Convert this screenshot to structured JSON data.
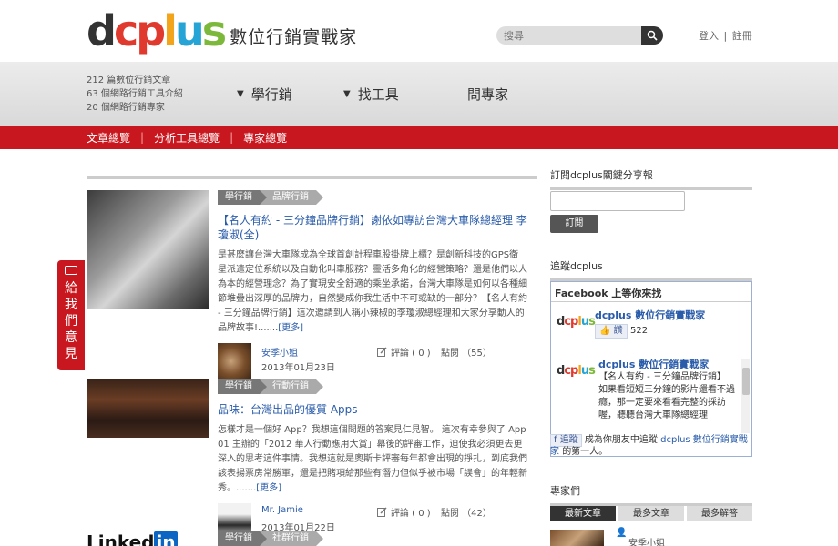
{
  "header": {
    "logo_text": "dcplus",
    "logo_subtitle": "數位行銷實戰家",
    "search_placeholder": "搜尋",
    "login_label": "登入",
    "register_label": "註冊",
    "link_separator": "|"
  },
  "stats": {
    "line1": "212 篇數位行銷文章",
    "line2": "63 個網路行銷工具介紹",
    "line3": "20 個網路行銷專家"
  },
  "main_nav": {
    "item1": "學行銷",
    "item2": "找工具",
    "item3": "問專家"
  },
  "sub_nav": {
    "item1": "文章總覽",
    "item2": "分析工具總覽",
    "item3": "專家總覽"
  },
  "feedback": {
    "label": "給我們意見"
  },
  "articles": [
    {
      "category": "學行銷",
      "subcategory": "品牌行銷",
      "title": "【名人有約 - 三分鐘品牌行銷】謝依如專訪台灣大車隊總經理 李瓊淑(全)",
      "body": "是甚麼讓台灣大車隊成為全球首創計程車股掛牌上櫃？是創新科技的GPS衛星派遣定位系統以及自動化叫車服務？靈活多角化的經營策略？還是他們以人為本的經營理念？為了實現安全舒適的乘坐承諾，台灣大車隊是如何以各種細節堆疊出深厚的品牌力，自然變成你我生活中不可或缺的一部分？【名人有約 - 三分鐘品牌行銷】這次邀請到人稱小辣椒的李瓊淑總經理和大家分享動人的品牌故事!.......",
      "more": "[更多]",
      "author": "安季小姐",
      "date": "2013年01月23日",
      "comments": "評論 ( 0 )",
      "views": "點閱 （55）"
    },
    {
      "category": "學行銷",
      "subcategory": "行動行銷",
      "title": "品味：台灣出品的優質 Apps",
      "body": "怎樣才是一個好 App？我想這個問題的答案見仁見智。 這次有幸參與了 App 01 主辦的「2012 華人行動應用大賞」幕後的評審工作，迫使我必須更去更深入的思考這件事情。我想這就是奧斯卡評審每年都會出現的掙扎，到底我們該表揚票房常勝軍，還是把賭項給那些有潛力但似乎被市場「誤會」的年輕新秀。.......",
      "more": "[更多]",
      "author": "Mr. Jamie",
      "date": "2013年01月22日",
      "comments": "評論 ( 0 )",
      "views": "點閱 （42）"
    },
    {
      "category": "學行銷",
      "subcategory": "社群行銷",
      "thumb_text": "Linked",
      "thumb_badge": "in"
    }
  ],
  "sidebar": {
    "subscribe_heading": "訂閱dcplus關鍵分享報",
    "subscribe_button": "訂閱",
    "follow_heading": "追蹤dcplus",
    "fb_header": "Facebook 上等你來找",
    "fb_page_name": "dcplus 數位行銷實戰家",
    "fb_like_label": "讚",
    "fb_like_count": "522",
    "fb_post_title": "dcplus 數位行銷實戰家",
    "fb_post_body": "【名人有約 - 三分鐘品牌行銷】 如果看短短三分鐘的影片還看不過癮，那一定要來看看完整的採訪喔，聽聽台灣大車隊總經理",
    "fb_footer_button": "追蹤",
    "fb_footer_text1": "成為你朋友中追蹤",
    "fb_footer_page": "dcplus 數位行銷實戰家",
    "fb_footer_text2": "的第一人。",
    "experts_heading": "專家們",
    "tabs": [
      "最新文章",
      "最多文章",
      "最多解答"
    ],
    "expert_name": "安季小姐"
  },
  "colors": {
    "brand_red": "#c8171e",
    "link_blue": "#2a5caa",
    "logo_orange": "#f2a51a",
    "logo_blue": "#27a4d6",
    "logo_green": "#7cb93a"
  }
}
